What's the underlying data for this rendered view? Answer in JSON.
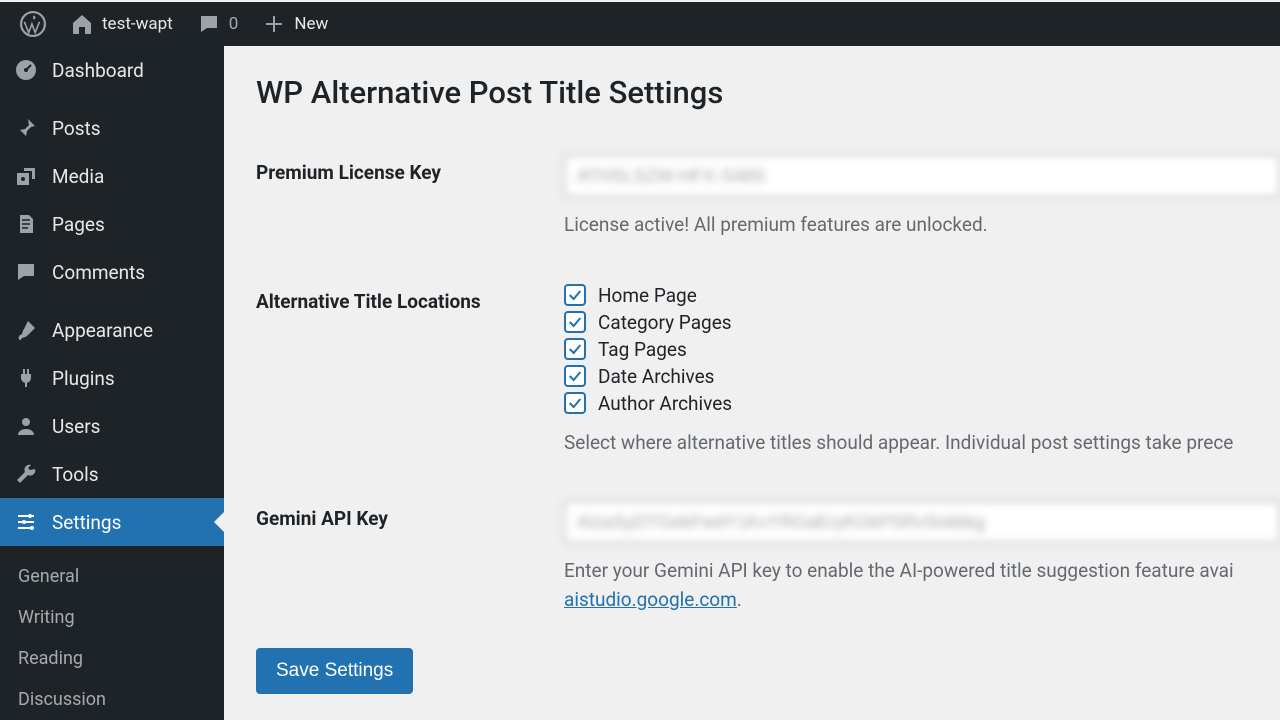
{
  "adminbar": {
    "site_name": "test-wapt",
    "comments_count": "0",
    "new_label": "New"
  },
  "sidebar": {
    "items": [
      {
        "label": "Dashboard"
      },
      {
        "label": "Posts"
      },
      {
        "label": "Media"
      },
      {
        "label": "Pages"
      },
      {
        "label": "Comments"
      },
      {
        "label": "Appearance"
      },
      {
        "label": "Plugins"
      },
      {
        "label": "Users"
      },
      {
        "label": "Tools"
      },
      {
        "label": "Settings"
      }
    ],
    "submenu": [
      {
        "label": "General"
      },
      {
        "label": "Writing"
      },
      {
        "label": "Reading"
      },
      {
        "label": "Discussion"
      }
    ]
  },
  "page": {
    "title": "WP Alternative Post Title Settings",
    "license": {
      "label": "Premium License Key",
      "value": "ATHSLSZW-HFX-S48S",
      "helper": "License active! All premium features are unlocked."
    },
    "locations": {
      "label": "Alternative Title Locations",
      "options": [
        {
          "label": "Home Page",
          "checked": true
        },
        {
          "label": "Category Pages",
          "checked": true
        },
        {
          "label": "Tag Pages",
          "checked": true
        },
        {
          "label": "Date Archives",
          "checked": true
        },
        {
          "label": "Author Archives",
          "checked": true
        }
      ],
      "helper": "Select where alternative titles should appear. Individual post settings take prece"
    },
    "gemini": {
      "label": "Gemini API Key",
      "value": "AIzaSyDTGekFwdY1KvYRGaEryKGkPSRvSnkbkg",
      "helper_pre": "Enter your Gemini API key to enable the AI-powered title suggestion feature avai",
      "helper_link": "aistudio.google.com",
      "helper_post": "."
    },
    "save_label": "Save Settings"
  }
}
